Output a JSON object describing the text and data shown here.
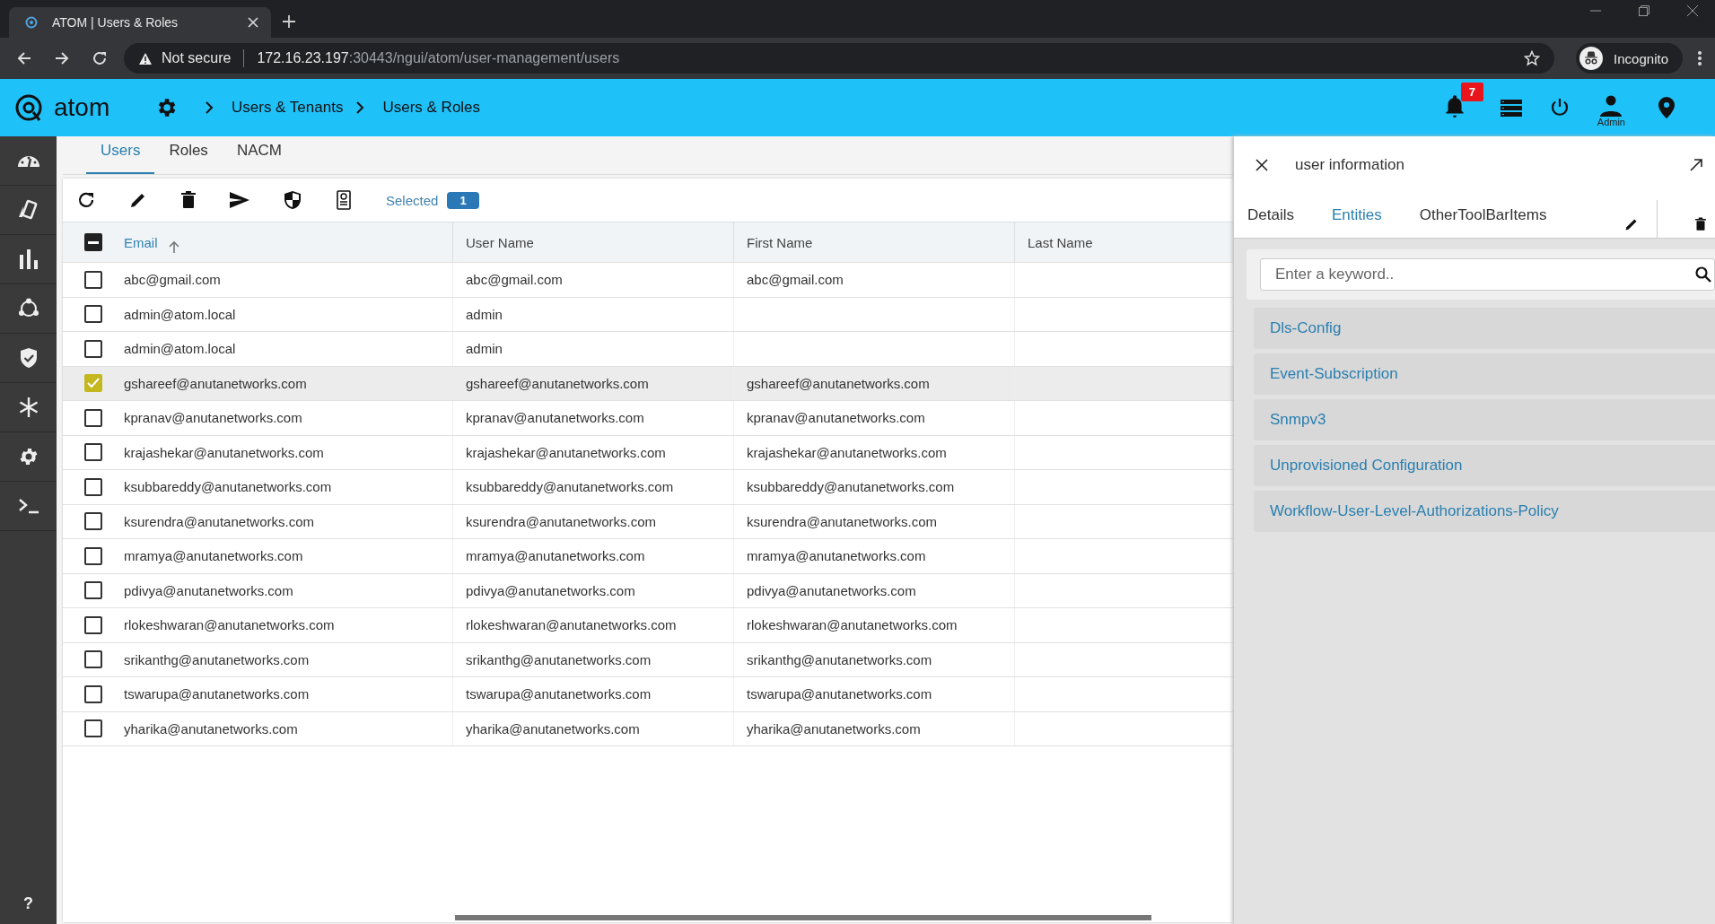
{
  "browser": {
    "tab_title": "ATOM | Users & Roles",
    "security": "Not secure",
    "url_host": "172.16.23.197",
    "url_path": ":30443/ngui/atom/user-management/users",
    "profile": "Incognito"
  },
  "header": {
    "logo": "atom",
    "breadcrumbs": [
      "Users & Tenants",
      "Users & Roles"
    ],
    "notifications": "7",
    "user": "Admin"
  },
  "sidebar": {
    "help": "?"
  },
  "tabs": [
    {
      "label": "Users",
      "selected": true
    },
    {
      "label": "Roles",
      "selected": false
    },
    {
      "label": "NACM",
      "selected": false
    }
  ],
  "toolbar": {
    "selected_label": "Selected",
    "selected_count": "1"
  },
  "table": {
    "columns": [
      "Email",
      "User Name",
      "First Name",
      "Last Name"
    ],
    "select_all_indeterminate": true,
    "rows": [
      {
        "email": "abc@gmail.com",
        "user_name": "abc@gmail.com",
        "first_name": "abc@gmail.com",
        "selected": false
      },
      {
        "email": "admin@atom.local",
        "user_name": "admin",
        "selected": false
      },
      {
        "email": "admin@atom.local",
        "user_name": "admin",
        "selected": false
      },
      {
        "email": "gshareef@anutanetworks.com",
        "user_name": "gshareef@anutanetworks.com",
        "first_name": "gshareef@anutanetworks.com",
        "selected": true
      },
      {
        "email": "kpranav@anutanetworks.com",
        "user_name": "kpranav@anutanetworks.com",
        "first_name": "kpranav@anutanetworks.com",
        "selected": false
      },
      {
        "email": "krajashekar@anutanetworks.com",
        "user_name": "krajashekar@anutanetworks.com",
        "first_name": "krajashekar@anutanetworks.com",
        "selected": false
      },
      {
        "email": "ksubbareddy@anutanetworks.com",
        "user_name": "ksubbareddy@anutanetworks.com",
        "first_name": "ksubbareddy@anutanetworks.com",
        "selected": false
      },
      {
        "email": "ksurendra@anutanetworks.com",
        "user_name": "ksurendra@anutanetworks.com",
        "first_name": "ksurendra@anutanetworks.com",
        "selected": false
      },
      {
        "email": "mramya@anutanetworks.com",
        "user_name": "mramya@anutanetworks.com",
        "first_name": "mramya@anutanetworks.com",
        "selected": false
      },
      {
        "email": "pdivya@anutanetworks.com",
        "user_name": "pdivya@anutanetworks.com",
        "first_name": "pdivya@anutanetworks.com",
        "selected": false
      },
      {
        "email": "rlokeshwaran@anutanetworks.com",
        "user_name": "rlokeshwaran@anutanetworks.com",
        "first_name": "rlokeshwaran@anutanetworks.com",
        "selected": false
      },
      {
        "email": "srikanthg@anutanetworks.com",
        "user_name": "srikanthg@anutanetworks.com",
        "first_name": "srikanthg@anutanetworks.com",
        "selected": false
      },
      {
        "email": "tswarupa@anutanetworks.com",
        "user_name": "tswarupa@anutanetworks.com",
        "first_name": "tswarupa@anutanetworks.com",
        "selected": false
      },
      {
        "email": "yharika@anutanetworks.com",
        "user_name": "yharika@anutanetworks.com",
        "first_name": "yharika@anutanetworks.com",
        "selected": false
      }
    ]
  },
  "panel": {
    "title": "user information",
    "tabs": [
      {
        "label": "Details",
        "selected": false
      },
      {
        "label": "Entities",
        "selected": true
      },
      {
        "label": "OtherToolBarItems",
        "selected": false
      }
    ],
    "search": {
      "placeholder": "Enter a keyword.."
    },
    "entities": [
      "Dls-Config",
      "Event-Subscription",
      "Snmpv3",
      "Unprovisioned Configuration",
      "Workflow-User-Level-Authorizations-Policy"
    ]
  }
}
